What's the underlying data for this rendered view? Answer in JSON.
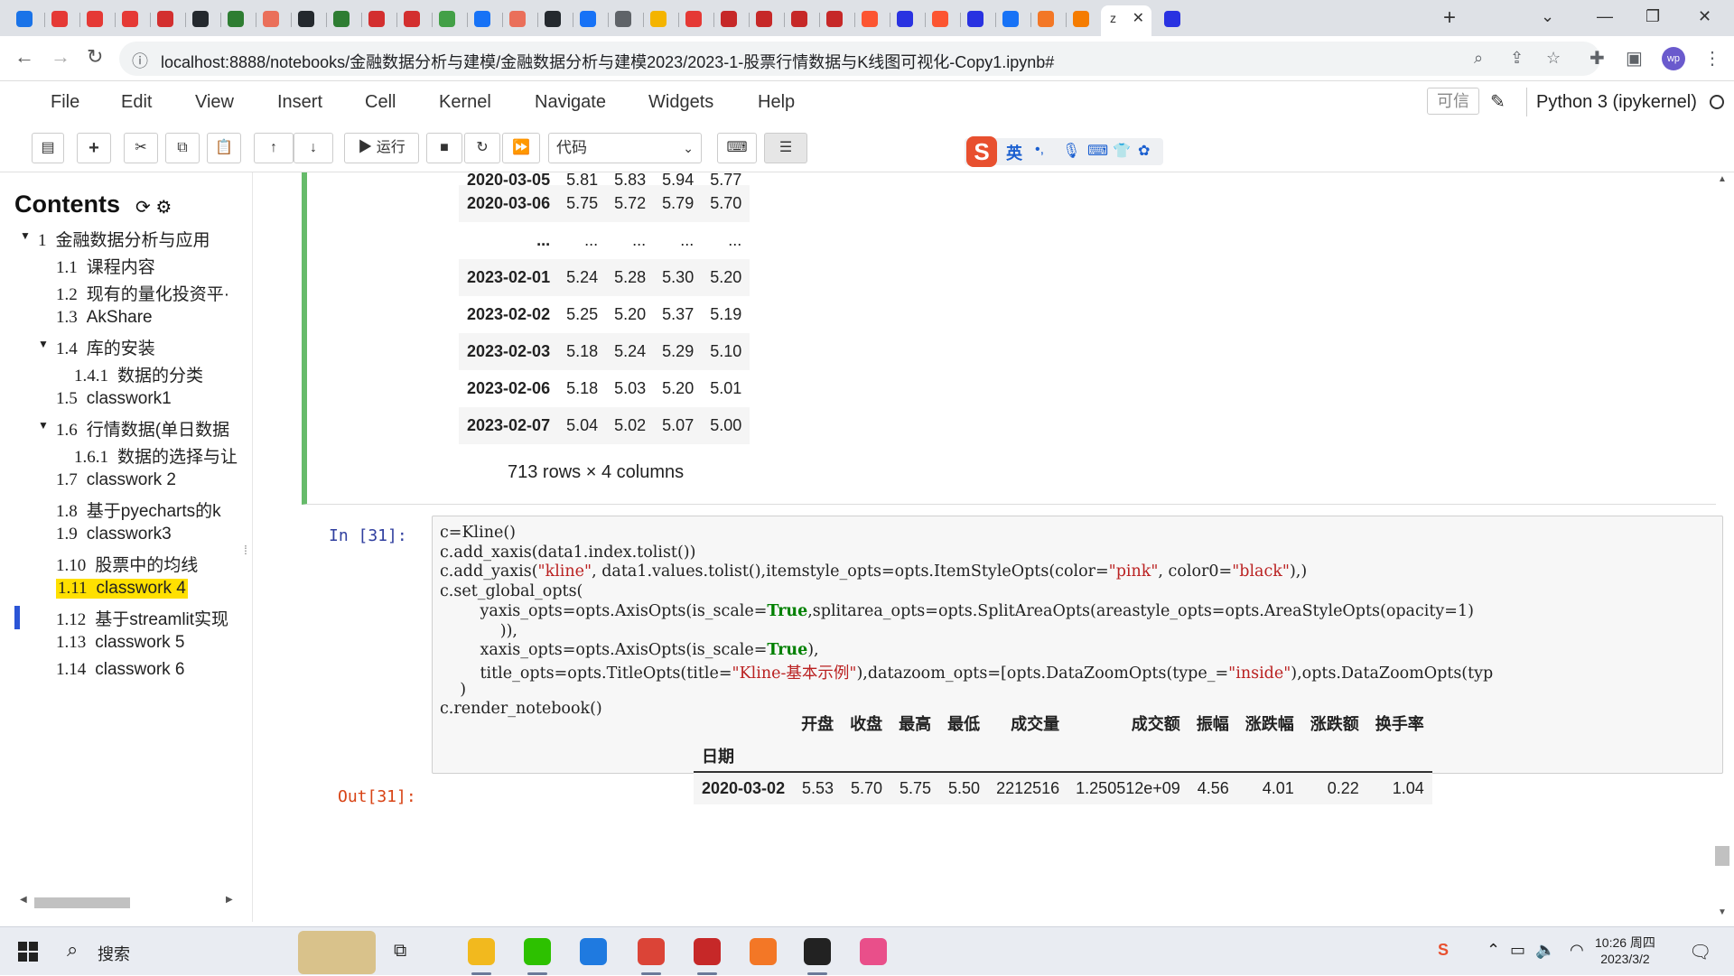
{
  "browser": {
    "tabs": [
      {
        "icon": "calendar-icon",
        "color": "#1a73e8"
      },
      {
        "icon": "record-icon",
        "color": "#e53935"
      },
      {
        "icon": "record-icon",
        "color": "#e53935"
      },
      {
        "icon": "record-icon",
        "color": "#e53935"
      },
      {
        "icon": "news-icon",
        "color": "#d32f2f"
      },
      {
        "icon": "github-icon",
        "color": "#24292e"
      },
      {
        "icon": "chat-icon",
        "color": "#2e7d32"
      },
      {
        "icon": "jianshu-icon",
        "color": "#ea6f5a"
      },
      {
        "icon": "github-icon",
        "color": "#24292e"
      },
      {
        "icon": "flag-icon",
        "color": "#2e7d32"
      },
      {
        "icon": "crown-icon",
        "color": "#d32f2f"
      },
      {
        "icon": "crown-icon",
        "color": "#d32f2f"
      },
      {
        "icon": "chart-icon",
        "color": "#43a047"
      },
      {
        "icon": "zhihu-icon",
        "color": "#1772f6"
      },
      {
        "icon": "jianshu-icon",
        "color": "#ea6f5a"
      },
      {
        "icon": "github-icon",
        "color": "#24292e"
      },
      {
        "icon": "zhihu-icon",
        "color": "#1772f6"
      },
      {
        "icon": "globe-icon",
        "color": "#5f6368"
      },
      {
        "icon": "smile-icon",
        "color": "#f4b400"
      },
      {
        "icon": "youtube-icon",
        "color": "#e53935"
      },
      {
        "icon": "opera-icon",
        "color": "#c62828"
      },
      {
        "icon": "opera-icon",
        "color": "#c62828"
      },
      {
        "icon": "opera-icon",
        "color": "#c62828"
      },
      {
        "icon": "opera-icon",
        "color": "#c62828"
      },
      {
        "icon": "csdn-icon",
        "color": "#fc5531"
      },
      {
        "icon": "baidu-icon",
        "color": "#2932e1"
      },
      {
        "icon": "csdn-icon",
        "color": "#fc5531"
      },
      {
        "icon": "baidu-icon",
        "color": "#2932e1"
      },
      {
        "icon": "zhihu-icon",
        "color": "#1772f6"
      },
      {
        "icon": "jupyter-icon",
        "color": "#f37726"
      },
      {
        "icon": "pen-icon",
        "color": "#f57c00"
      }
    ],
    "active_tab": {
      "title": "z",
      "close": "✕"
    },
    "tab_after_active": {
      "icon": "baidu-icon",
      "color": "#2932e1"
    },
    "new_tab": "+",
    "url": "localhost:8888/notebooks/金融数据分析与建模/金融数据分析与建模2023/2023-1-股票行情数据与K线图可视化-Copy1.ipynb#",
    "profile": "wp"
  },
  "jupyter": {
    "menu": [
      "File",
      "Edit",
      "View",
      "Insert",
      "Cell",
      "Kernel",
      "Navigate",
      "Widgets",
      "Help"
    ],
    "trusted": "可信",
    "kernel": "Python 3 (ipykernel)",
    "run_label": "运行",
    "cell_type": "代码"
  },
  "ime": {
    "logo": "S",
    "lang": "英",
    "icons": [
      "punct-icon",
      "mic-icon",
      "keyboard-icon",
      "shirt-icon",
      "apps-icon"
    ]
  },
  "toc": {
    "title": "Contents",
    "items": [
      {
        "num": "1",
        "label": "金融数据分析与应用",
        "level": 0,
        "collapsible": true
      },
      {
        "num": "1.1",
        "label": "课程内容",
        "level": 1
      },
      {
        "num": "1.2",
        "label": "现有的量化投资平·",
        "level": 1
      },
      {
        "num": "1.3",
        "label": "AkShare",
        "level": 1
      },
      {
        "num": "1.4",
        "label": "库的安装",
        "level": 1,
        "collapsible": true
      },
      {
        "num": "1.4.1",
        "label": "数据的分类",
        "level": 2
      },
      {
        "num": "1.5",
        "label": "classwork1",
        "level": 1
      },
      {
        "num": "1.6",
        "label": "行情数据(单日数据",
        "level": 1,
        "collapsible": true
      },
      {
        "num": "1.6.1",
        "label": "数据的选择与让",
        "level": 2
      },
      {
        "num": "1.7",
        "label": "classwork 2",
        "level": 1
      },
      {
        "num": "1.8",
        "label": "基于pyecharts的k",
        "level": 1
      },
      {
        "num": "1.9",
        "label": "classwork3",
        "level": 1
      },
      {
        "num": "1.10",
        "label": "股票中的均线",
        "level": 1
      },
      {
        "num": "1.11",
        "label": "classwork 4",
        "level": 1,
        "highlighted": true
      },
      {
        "num": "1.12",
        "label": "基于streamlit实现",
        "level": 1
      },
      {
        "num": "1.13",
        "label": "classwork 5",
        "level": 1
      },
      {
        "num": "1.14",
        "label": "classwork 6",
        "level": 1
      }
    ]
  },
  "df1": {
    "partial_row": [
      "2020-03-05",
      "5.81",
      "5.83",
      "5.94",
      "5.77"
    ],
    "rows": [
      [
        "2020-03-06",
        "5.75",
        "5.72",
        "5.79",
        "5.70"
      ],
      [
        "...",
        "...",
        "...",
        "...",
        "..."
      ],
      [
        "2023-02-01",
        "5.24",
        "5.28",
        "5.30",
        "5.20"
      ],
      [
        "2023-02-02",
        "5.25",
        "5.20",
        "5.37",
        "5.19"
      ],
      [
        "2023-02-03",
        "5.18",
        "5.24",
        "5.29",
        "5.10"
      ],
      [
        "2023-02-06",
        "5.18",
        "5.03",
        "5.20",
        "5.01"
      ],
      [
        "2023-02-07",
        "5.04",
        "5.02",
        "5.07",
        "5.00"
      ]
    ],
    "summary": "713 rows × 4 columns"
  },
  "cell31": {
    "in_prompt": "In  [31]:",
    "out_prompt": "Out[31]:",
    "lines": [
      [
        {
          "t": "c=Kline()"
        }
      ],
      [
        {
          "t": "c.add_xaxis(data1.index.tolist())"
        }
      ],
      [
        {
          "t": "c.add_yaxis("
        },
        {
          "t": "\"kline\"",
          "c": "s"
        },
        {
          "t": ", data1.values.tolist(),itemstyle_opts=opts.ItemStyleOpts(color="
        },
        {
          "t": "\"pink\"",
          "c": "s"
        },
        {
          "t": ", color0="
        },
        {
          "t": "\"black\"",
          "c": "s"
        },
        {
          "t": "),)"
        }
      ],
      [
        {
          "t": "c.set_global_opts("
        }
      ],
      [
        {
          "t": "        yaxis_opts=opts.AxisOpts(is_scale="
        },
        {
          "t": "True",
          "c": "k"
        },
        {
          "t": ",splitarea_opts=opts.SplitAreaOpts(areastyle_opts=opts.AreaStyleOpts(opacity=1)"
        }
      ],
      [
        {
          "t": "            )),"
        }
      ],
      [
        {
          "t": "        xaxis_opts=opts.AxisOpts(is_scale="
        },
        {
          "t": "True",
          "c": "k"
        },
        {
          "t": "),"
        }
      ],
      [
        {
          "t": "        title_opts=opts.TitleOpts(title="
        },
        {
          "t": "\"Kline-基本示例\"",
          "c": "s"
        },
        {
          "t": "),datazoom_opts=[opts.DataZoomOpts(type_="
        },
        {
          "t": "\"inside\"",
          "c": "s"
        },
        {
          "t": "),opts.DataZoomOpts(typ"
        }
      ],
      [
        {
          "t": "    )"
        }
      ],
      [
        {
          "t": "c.render_notebook()"
        }
      ]
    ]
  },
  "df2": {
    "columns": [
      "开盘",
      "收盘",
      "最高",
      "最低",
      "成交量",
      "成交额",
      "振幅",
      "涨跌幅",
      "涨跌额",
      "换手率"
    ],
    "index_name": "日期",
    "rows": [
      [
        "2020-03-02",
        "5.53",
        "5.70",
        "5.75",
        "5.50",
        "2212516",
        "1.250512e+09",
        "4.56",
        "4.01",
        "0.22",
        "1.04"
      ]
    ]
  },
  "taskbar": {
    "search": "搜索",
    "apps": [
      {
        "icon": "file-explorer-icon",
        "color": "#f2b91e",
        "running": true
      },
      {
        "icon": "wechat-icon",
        "color": "#2dc100",
        "running": true
      },
      {
        "icon": "feishu-icon",
        "color": "#1f7ae0",
        "running": false
      },
      {
        "icon": "chrome-icon",
        "color": "#db4437",
        "running": true
      },
      {
        "icon": "xmind-icon",
        "color": "#c62828",
        "running": true
      },
      {
        "icon": "jupyter-icon",
        "color": "#f37726",
        "running": false
      },
      {
        "icon": "bot-icon",
        "color": "#222222",
        "running": true
      },
      {
        "icon": "photo-app-icon",
        "color": "#e94f8a",
        "running": false
      }
    ],
    "time": "10:26 周四",
    "date": "2023/3/2"
  }
}
